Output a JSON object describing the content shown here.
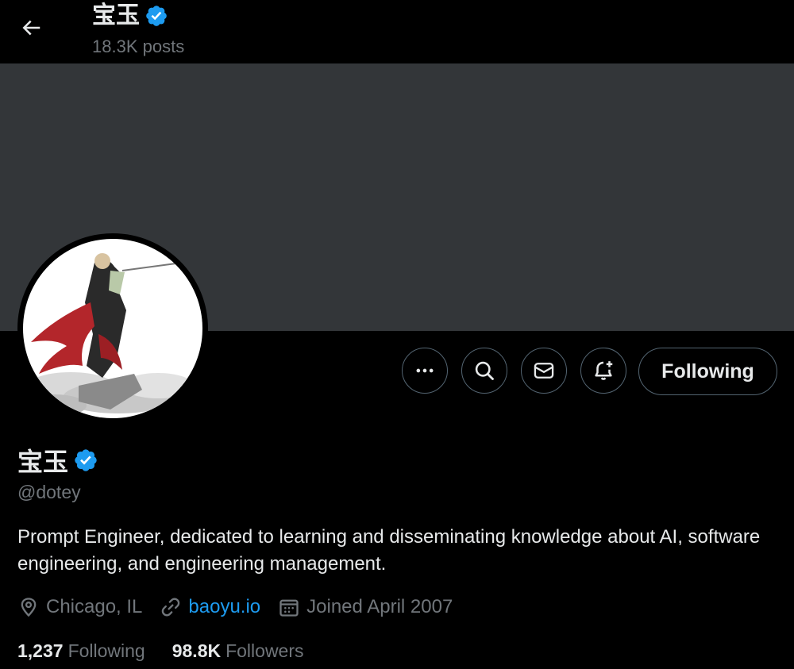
{
  "header": {
    "name": "宝玉",
    "posts_count": "18.3K posts"
  },
  "profile": {
    "name": "宝玉",
    "handle": "@dotey",
    "bio": "Prompt Engineer, dedicated to learning and disseminating knowledge about AI, software engineering, and engineering management.",
    "location": "Chicago, IL",
    "website": "baoyu.io",
    "joined": "Joined April 2007"
  },
  "actions": {
    "more_icon": "more-icon",
    "search_icon": "search-icon",
    "message_icon": "envelope-icon",
    "notify_icon": "bell-plus-icon",
    "follow_label": "Following"
  },
  "stats": {
    "following_count": "1,237",
    "following_label": "Following",
    "followers_count": "98.8K",
    "followers_label": "Followers"
  },
  "colors": {
    "background": "#000000",
    "banner": "#333639",
    "accent": "#1d9bf0",
    "secondary_text": "#71767b",
    "primary_text": "#e7e9ea"
  }
}
